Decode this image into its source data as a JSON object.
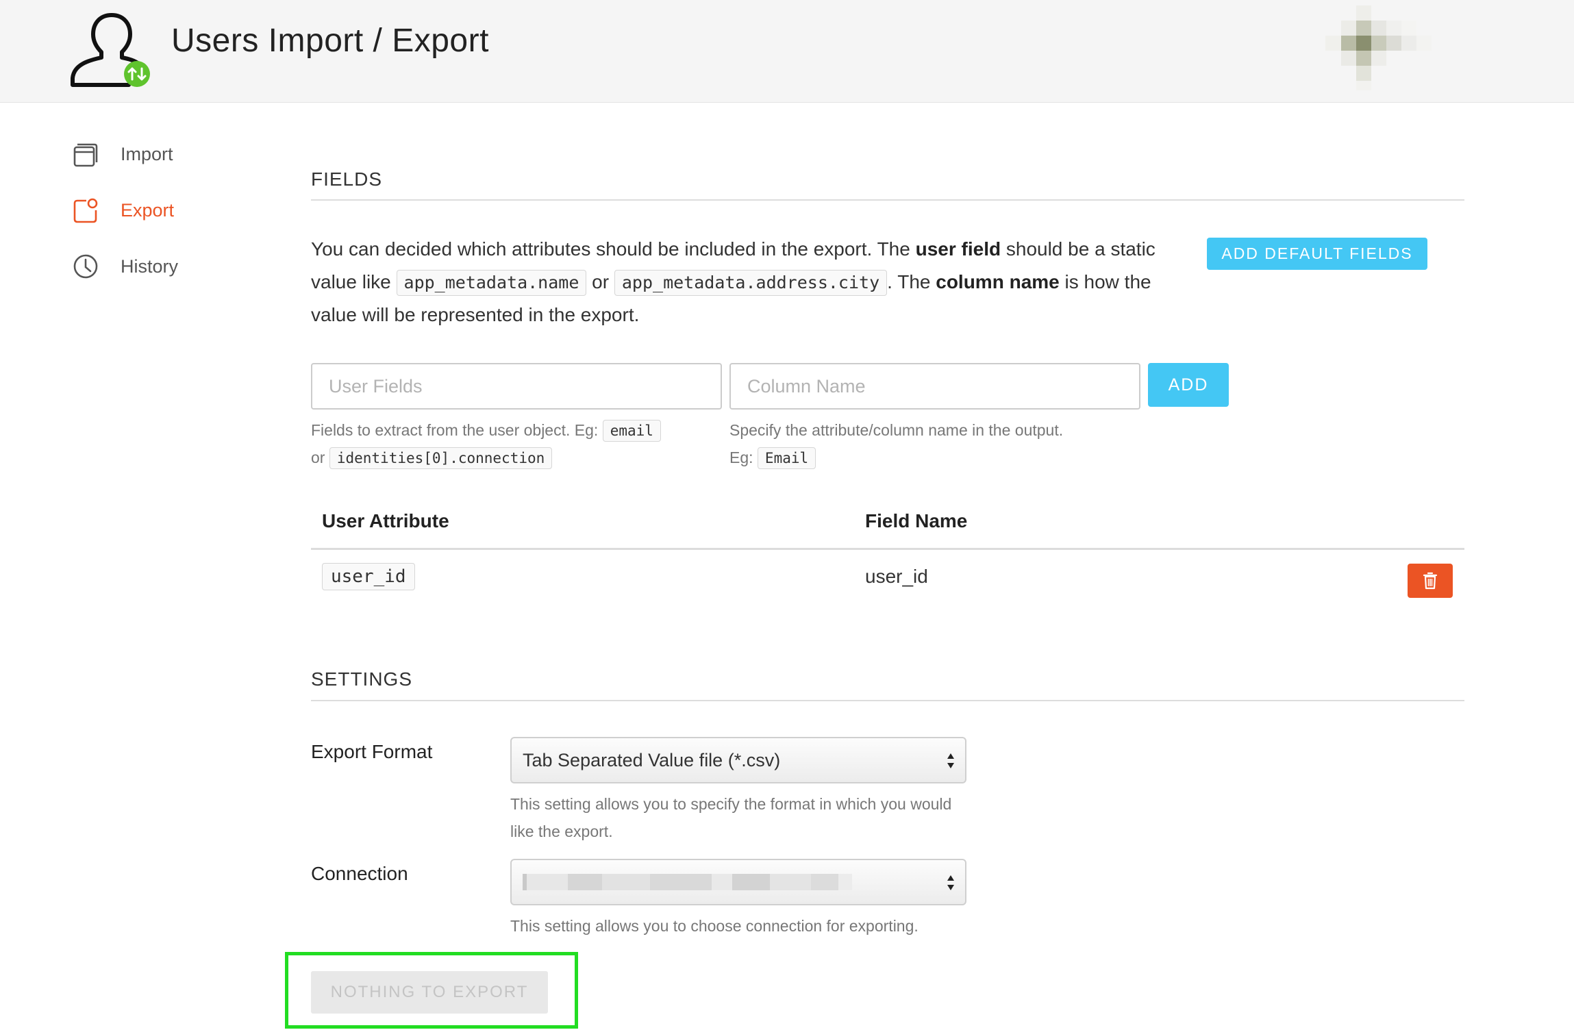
{
  "app": {
    "title": "Users Import / Export",
    "icon": "user-import-export-icon",
    "badge_color": "#5fc32d"
  },
  "sidebar": {
    "items": [
      {
        "label": "Import",
        "icon": "import-icon",
        "active": false
      },
      {
        "label": "Export",
        "icon": "export-icon",
        "active": true
      },
      {
        "label": "History",
        "icon": "clock-icon",
        "active": false
      }
    ]
  },
  "fields": {
    "title": "FIELDS",
    "description": {
      "p1": "You can decided which attributes should be included in the export. The ",
      "b1": "user field",
      "p2": " should be a static value like ",
      "code1": "app_metadata.name",
      "p3": " or ",
      "code2": "app_metadata.address.city",
      "p4": ". The ",
      "b2": "column name",
      "p5": " is how the value will be represented in the export."
    },
    "add_default_label": "ADD DEFAULT FIELDS",
    "user_fields_placeholder": "User Fields",
    "column_name_placeholder": "Column Name",
    "add_label": "ADD",
    "user_fields_help": {
      "text1": "Fields to extract from the user object. Eg:",
      "code1": "email",
      "text2": "or",
      "code2": "identities[0].connection"
    },
    "column_help": {
      "text1": "Specify the attribute/column name in the output.",
      "text2": "Eg:",
      "code1": "Email"
    },
    "table": {
      "headers": [
        "User Attribute",
        "Field Name"
      ],
      "rows": [
        {
          "attribute": "user_id",
          "field_name": "user_id"
        }
      ]
    }
  },
  "settings": {
    "title": "SETTINGS",
    "export_format_label": "Export Format",
    "export_format_value": "Tab Separated Value file (*.csv)",
    "export_format_help": "This setting allows you to specify the format in which you would like the export.",
    "connection_label": "Connection",
    "connection_help": "This setting allows you to choose connection for exporting."
  },
  "action": {
    "label": "NOTHING TO EXPORT"
  },
  "colors": {
    "accent": "#eb5424",
    "primary_button": "#44c7f4",
    "highlight_outline": "#22dd22"
  }
}
